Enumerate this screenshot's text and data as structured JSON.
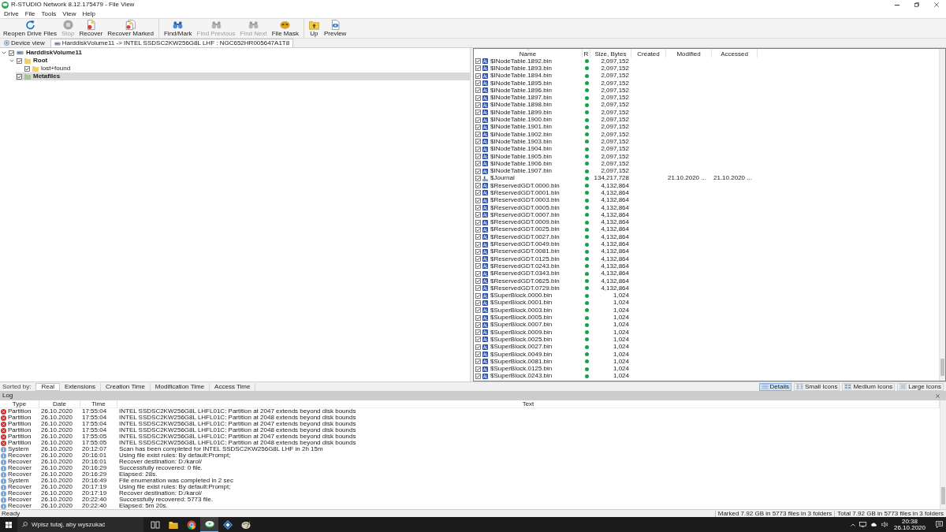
{
  "window": {
    "title": "R-STUDIO Network 8.12.175479 - File View"
  },
  "menu": [
    "Drive",
    "File",
    "Tools",
    "View",
    "Help"
  ],
  "toolbar": [
    [
      {
        "label": "Reopen Drive Files",
        "disabled": false
      },
      {
        "label": "Stop",
        "disabled": true
      },
      {
        "label": "Recover",
        "disabled": false
      },
      {
        "label": "Recover Marked",
        "disabled": false
      }
    ],
    [
      {
        "label": "Find/Mark",
        "disabled": false
      },
      {
        "label": "Find Previous",
        "disabled": true
      },
      {
        "label": "Find Next",
        "disabled": true
      },
      {
        "label": "File Mask",
        "disabled": false
      }
    ],
    [
      {
        "label": "Up",
        "disabled": false
      },
      {
        "label": "Preview",
        "disabled": false
      }
    ]
  ],
  "tabs": [
    {
      "label": "Device view",
      "selected": false
    },
    {
      "label": "HarddiskVolume11 -> INTEL SSDSC2KW256G8L LHF : NGC652HR005647A1T8",
      "selected": true
    }
  ],
  "tree": [
    {
      "label": "HarddiskVolume11",
      "kind": "drive",
      "bold": true,
      "checked": true,
      "selected": false,
      "expanded": true,
      "children": [
        {
          "label": "Root",
          "kind": "folder",
          "bold": true,
          "checked": true,
          "selected": false,
          "expanded": true,
          "children": [
            {
              "label": "lost+found",
              "kind": "folder",
              "bold": false,
              "checked": true,
              "selected": false
            }
          ]
        },
        {
          "label": "Metafiles",
          "kind": "metafolder",
          "bold": true,
          "checked": true,
          "selected": true
        }
      ]
    }
  ],
  "files": {
    "columns": [
      {
        "label": "Name",
        "sorted": true
      },
      {
        "label": "R",
        "sorted": false
      },
      {
        "label": "Size, Bytes",
        "sorted": false
      },
      {
        "label": "Created",
        "sorted": false
      },
      {
        "label": "Modified",
        "sorted": false
      },
      {
        "label": "Accessed",
        "sorted": false
      }
    ],
    "rows": [
      {
        "kind": "file",
        "name": "$INodeTable.1892.bin",
        "checked": true,
        "color": "#1f9d4e",
        "size": "2,097,152"
      },
      {
        "kind": "file",
        "name": "$INodeTable.1893.bin",
        "checked": true,
        "color": "#1f9d4e",
        "size": "2,097,152"
      },
      {
        "kind": "file",
        "name": "$INodeTable.1894.bin",
        "checked": true,
        "color": "#1f9d4e",
        "size": "2,097,152"
      },
      {
        "kind": "file",
        "name": "$INodeTable.1895.bin",
        "checked": true,
        "color": "#1f9d4e",
        "size": "2,097,152"
      },
      {
        "kind": "file",
        "name": "$INodeTable.1896.bin",
        "checked": true,
        "color": "#1f9d4e",
        "size": "2,097,152"
      },
      {
        "kind": "file",
        "name": "$INodeTable.1897.bin",
        "checked": true,
        "color": "#1f9d4e",
        "size": "2,097,152"
      },
      {
        "kind": "file",
        "name": "$INodeTable.1898.bin",
        "checked": true,
        "color": "#1f9d4e",
        "size": "2,097,152"
      },
      {
        "kind": "file",
        "name": "$INodeTable.1899.bin",
        "checked": true,
        "color": "#1f9d4e",
        "size": "2,097,152"
      },
      {
        "kind": "file",
        "name": "$INodeTable.1900.bin",
        "checked": true,
        "color": "#1f9d4e",
        "size": "2,097,152"
      },
      {
        "kind": "file",
        "name": "$INodeTable.1901.bin",
        "checked": true,
        "color": "#1f9d4e",
        "size": "2,097,152"
      },
      {
        "kind": "file",
        "name": "$INodeTable.1902.bin",
        "checked": true,
        "color": "#1f9d4e",
        "size": "2,097,152"
      },
      {
        "kind": "file",
        "name": "$INodeTable.1903.bin",
        "checked": true,
        "color": "#1f9d4e",
        "size": "2,097,152"
      },
      {
        "kind": "file",
        "name": "$INodeTable.1904.bin",
        "checked": true,
        "color": "#1f9d4e",
        "size": "2,097,152"
      },
      {
        "kind": "file",
        "name": "$INodeTable.1905.bin",
        "checked": true,
        "color": "#1f9d4e",
        "size": "2,097,152"
      },
      {
        "kind": "file",
        "name": "$INodeTable.1906.bin",
        "checked": true,
        "color": "#1f9d4e",
        "size": "2,097,152"
      },
      {
        "kind": "file",
        "name": "$INodeTable.1907.bin",
        "checked": true,
        "color": "#1f9d4e",
        "size": "2,097,152"
      },
      {
        "kind": "journal",
        "name": "$Journal",
        "checked": true,
        "color": "#1f9d4e",
        "size": "134,217,728",
        "modified": "21.10.2020 ...",
        "accessed": "21.10.2020 ..."
      },
      {
        "kind": "file",
        "name": "$ReservedGDT.0000.bin",
        "checked": true,
        "color": "#1f9d4e",
        "size": "4,132,864"
      },
      {
        "kind": "file",
        "name": "$ReservedGDT.0001.bin",
        "checked": true,
        "color": "#1f9d4e",
        "size": "4,132,864"
      },
      {
        "kind": "file",
        "name": "$ReservedGDT.0003.bin",
        "checked": true,
        "color": "#1f9d4e",
        "size": "4,132,864"
      },
      {
        "kind": "file",
        "name": "$ReservedGDT.0005.bin",
        "checked": true,
        "color": "#1f9d4e",
        "size": "4,132,864"
      },
      {
        "kind": "file",
        "name": "$ReservedGDT.0007.bin",
        "checked": true,
        "color": "#1f9d4e",
        "size": "4,132,864"
      },
      {
        "kind": "file",
        "name": "$ReservedGDT.0009.bin",
        "checked": true,
        "color": "#1f9d4e",
        "size": "4,132,864"
      },
      {
        "kind": "file",
        "name": "$ReservedGDT.0025.bin",
        "checked": true,
        "color": "#1f9d4e",
        "size": "4,132,864"
      },
      {
        "kind": "file",
        "name": "$ReservedGDT.0027.bin",
        "checked": true,
        "color": "#1f9d4e",
        "size": "4,132,864"
      },
      {
        "kind": "file",
        "name": "$ReservedGDT.0049.bin",
        "checked": true,
        "color": "#1f9d4e",
        "size": "4,132,864"
      },
      {
        "kind": "file",
        "name": "$ReservedGDT.0081.bin",
        "checked": true,
        "color": "#1f9d4e",
        "size": "4,132,864"
      },
      {
        "kind": "file",
        "name": "$ReservedGDT.0125.bin",
        "checked": true,
        "color": "#1f9d4e",
        "size": "4,132,864"
      },
      {
        "kind": "file",
        "name": "$ReservedGDT.0243.bin",
        "checked": true,
        "color": "#1f9d4e",
        "size": "4,132,864"
      },
      {
        "kind": "file",
        "name": "$ReservedGDT.0343.bin",
        "checked": true,
        "color": "#1f9d4e",
        "size": "4,132,864"
      },
      {
        "kind": "file",
        "name": "$ReservedGDT.0625.bin",
        "checked": true,
        "color": "#1f9d4e",
        "size": "4,132,864"
      },
      {
        "kind": "file",
        "name": "$ReservedGDT.0729.bin",
        "checked": true,
        "color": "#1f9d4e",
        "size": "4,132,864"
      },
      {
        "kind": "file",
        "name": "$SuperBlock.0000.bin",
        "checked": true,
        "color": "#1f9d4e",
        "size": "1,024"
      },
      {
        "kind": "file",
        "name": "$SuperBlock.0001.bin",
        "checked": true,
        "color": "#1f9d4e",
        "size": "1,024"
      },
      {
        "kind": "file",
        "name": "$SuperBlock.0003.bin",
        "checked": true,
        "color": "#1f9d4e",
        "size": "1,024"
      },
      {
        "kind": "file",
        "name": "$SuperBlock.0005.bin",
        "checked": true,
        "color": "#1f9d4e",
        "size": "1,024"
      },
      {
        "kind": "file",
        "name": "$SuperBlock.0007.bin",
        "checked": true,
        "color": "#1f9d4e",
        "size": "1,024"
      },
      {
        "kind": "file",
        "name": "$SuperBlock.0009.bin",
        "checked": true,
        "color": "#1f9d4e",
        "size": "1,024"
      },
      {
        "kind": "file",
        "name": "$SuperBlock.0025.bin",
        "checked": true,
        "color": "#1f9d4e",
        "size": "1,024"
      },
      {
        "kind": "file",
        "name": "$SuperBlock.0027.bin",
        "checked": true,
        "color": "#1f9d4e",
        "size": "1,024"
      },
      {
        "kind": "file",
        "name": "$SuperBlock.0049.bin",
        "checked": true,
        "color": "#1f9d4e",
        "size": "1,024"
      },
      {
        "kind": "file",
        "name": "$SuperBlock.0081.bin",
        "checked": true,
        "color": "#1f9d4e",
        "size": "1,024"
      },
      {
        "kind": "file",
        "name": "$SuperBlock.0125.bin",
        "checked": true,
        "color": "#1f9d4e",
        "size": "1,024"
      },
      {
        "kind": "file",
        "name": "$SuperBlock.0243.bin",
        "checked": true,
        "color": "#1f9d4e",
        "size": "1,024"
      }
    ]
  },
  "sort_bar": {
    "label": "Sorted by:",
    "tabs": [
      {
        "label": "Real",
        "selected": true
      },
      {
        "label": "Extensions",
        "selected": false
      },
      {
        "label": "Creation Time",
        "selected": false
      },
      {
        "label": "Modification Time",
        "selected": false
      },
      {
        "label": "Access Time",
        "selected": false
      }
    ]
  },
  "view_modes": [
    {
      "label": "Details",
      "selected": true
    },
    {
      "label": "Small Icons",
      "selected": false
    },
    {
      "label": "Medium Icons",
      "selected": false
    },
    {
      "label": "Large Icons",
      "selected": false
    }
  ],
  "log": {
    "title": "Log",
    "columns": [
      "Type",
      "Date",
      "Time",
      "Text"
    ],
    "rows": [
      {
        "kind": "error",
        "type": "Partition",
        "date": "26.10.2020",
        "time": "17:55:04",
        "text": "INTEL SSDSC2KW256G8L LHFL01C: Partition at 2047 extends beyond disk bounds"
      },
      {
        "kind": "error",
        "type": "Partition",
        "date": "26.10.2020",
        "time": "17:55:04",
        "text": "INTEL SSDSC2KW256G8L LHFL01C: Partition at 2048 extends beyond disk bounds"
      },
      {
        "kind": "error",
        "type": "Partition",
        "date": "26.10.2020",
        "time": "17:55:04",
        "text": "INTEL SSDSC2KW256G8L LHFL01C: Partition at 2047 extends beyond disk bounds"
      },
      {
        "kind": "error",
        "type": "Partition",
        "date": "26.10.2020",
        "time": "17:55:04",
        "text": "INTEL SSDSC2KW256G8L LHFL01C: Partition at 2048 extends beyond disk bounds"
      },
      {
        "kind": "error",
        "type": "Partition",
        "date": "26.10.2020",
        "time": "17:55:05",
        "text": "INTEL SSDSC2KW256G8L LHFL01C: Partition at 2047 extends beyond disk bounds"
      },
      {
        "kind": "error",
        "type": "Partition",
        "date": "26.10.2020",
        "time": "17:55:05",
        "text": "INTEL SSDSC2KW256G8L LHFL01C: Partition at 2048 extends beyond disk bounds"
      },
      {
        "kind": "info",
        "type": "System",
        "date": "26.10.2020",
        "time": "20:12:07",
        "text": "Scan has been completed for INTEL SSDSC2KW256G8L LHF in 2h 15m"
      },
      {
        "kind": "info",
        "type": "Recover",
        "date": "26.10.2020",
        "time": "20:16:01",
        "text": "Using file exist rules: By default:Prompt;"
      },
      {
        "kind": "info",
        "type": "Recover",
        "date": "26.10.2020",
        "time": "20:16:01",
        "text": "Recover destination: D:/karol/"
      },
      {
        "kind": "info",
        "type": "Recover",
        "date": "26.10.2020",
        "time": "20:16:29",
        "text": "Successfully recovered: 0 file."
      },
      {
        "kind": "info",
        "type": "Recover",
        "date": "26.10.2020",
        "time": "20:16:29",
        "text": "Elapsed: 28s."
      },
      {
        "kind": "info",
        "type": "System",
        "date": "26.10.2020",
        "time": "20:16:49",
        "text": "File enumeration was completed in 2 sec"
      },
      {
        "kind": "info",
        "type": "Recover",
        "date": "26.10.2020",
        "time": "20:17:19",
        "text": "Using file exist rules: By default:Prompt;"
      },
      {
        "kind": "info",
        "type": "Recover",
        "date": "26.10.2020",
        "time": "20:17:19",
        "text": "Recover destination: D:/karol/"
      },
      {
        "kind": "info",
        "type": "Recover",
        "date": "26.10.2020",
        "time": "20:22:40",
        "text": "Successfully recovered: 5773 file."
      },
      {
        "kind": "info",
        "type": "Recover",
        "date": "26.10.2020",
        "time": "20:22:40",
        "text": "Elapsed: 5m 20s."
      }
    ]
  },
  "status_bar": {
    "text": "Ready",
    "marked": "Marked 7.92 GB in 5773 files in 3 folders",
    "total": "Total 7.92 GB in 5773 files in 3 folders"
  },
  "taskbar": {
    "search": {
      "placeholder": "Wpisz tutaj, aby wyszukać"
    },
    "apps": [
      {
        "selected": false
      },
      {
        "selected": false
      },
      {
        "selected": false
      },
      {
        "selected": true
      },
      {
        "selected": false
      },
      {
        "selected": false
      }
    ],
    "time": "20:38",
    "date": "26.10.2020"
  }
}
